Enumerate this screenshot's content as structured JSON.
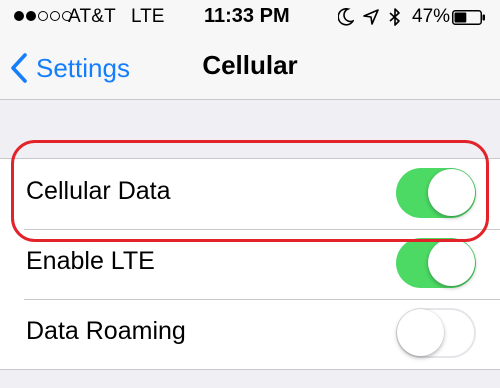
{
  "status_bar": {
    "carrier": "AT&T",
    "network": "LTE",
    "time": "11:33 PM",
    "battery_percent": "47%",
    "signal_bars_filled": 2,
    "signal_bars_total": 5,
    "battery_level": 0.47,
    "icons": [
      "moon-icon",
      "location-arrow-icon",
      "bluetooth-icon",
      "battery-icon"
    ]
  },
  "nav": {
    "back_label": "Settings",
    "title": "Cellular"
  },
  "settings": {
    "rows": [
      {
        "label": "Cellular Data",
        "enabled": true
      },
      {
        "label": "Enable LTE",
        "enabled": true
      },
      {
        "label": "Data Roaming",
        "enabled": false
      }
    ]
  },
  "colors": {
    "accent": "#147efb",
    "toggle_on": "#4cd964",
    "highlight": "#e3232a",
    "background": "#efeff4"
  }
}
